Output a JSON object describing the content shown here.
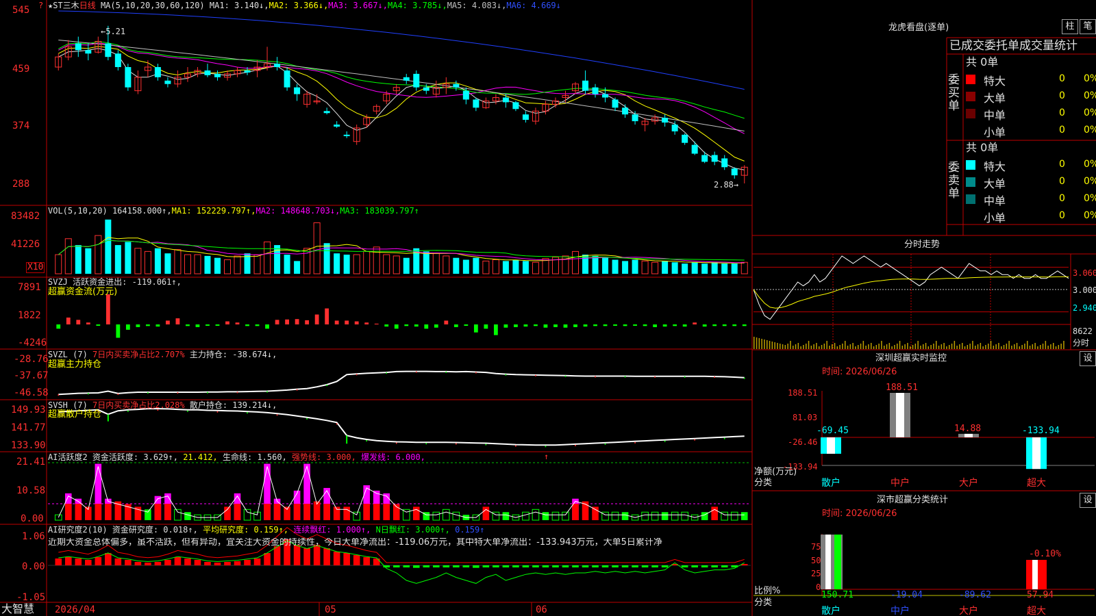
{
  "colors": {
    "up": "#ff3030",
    "down": "#00ffff",
    "frame": "#c00000",
    "ma1": "#e0e0e0",
    "ma2": "#ffff00",
    "ma3": "#ff00ff",
    "ma4": "#00ff00",
    "ma5": "#c0c0c0",
    "ma6": "#2040ff"
  },
  "main": {
    "star": "★",
    "name": "ST三木",
    "period": "日线",
    "ma_label": "MA(5,10,20,30,60,120)",
    "ma1": "MA1: 3.140↓,",
    "ma2": "MA2: 3.366↓,",
    "ma3": "MA3: 3.667↓,",
    "ma4": "MA4: 3.785↓,",
    "ma5": "MA5: 4.083↓,",
    "ma6": "MA6: 4.669↓",
    "y_ticks": [
      "545",
      "459",
      "374",
      "288"
    ],
    "high_label": "←5.21",
    "low_label": "2.88→",
    "corner_q": "?"
  },
  "vol": {
    "label": "VOL(5,10,20)",
    "value": "164158.000↑,",
    "ma1": "MA1: 152229.797↑,",
    "ma2": "MA2: 148648.703↓,",
    "ma3": "MA3: 183039.797↑",
    "y_ticks": [
      "83482",
      "41226"
    ],
    "unit": "X10"
  },
  "svzj": {
    "label": "SVZJ  活跃资金进出: -119.061↑,",
    "sub": "超赢资金流(万元)",
    "y_ticks": [
      "7891",
      "1822",
      "-4246"
    ]
  },
  "svzl": {
    "label": "SVZL (7)",
    "l2": "7日内买卖净占比2.707%",
    "l3": "主力持仓: -38.674↓,",
    "sub": "超赢主力持仓",
    "y_ticks": [
      "-28.76",
      "-37.67",
      "-46.58"
    ]
  },
  "svsh": {
    "label": "SVSH (7)",
    "l2": "7日内买卖净占比2.028%",
    "l3": "散户持仓: 139.214↓,",
    "sub": "超赢散户持仓",
    "y_ticks": [
      "149.93",
      "141.77",
      "133.90"
    ]
  },
  "ai_active": {
    "label": "AI活跃度2",
    "l2": "资金活跃度: 3.629↑,",
    "l3": "21.412,",
    "l4": "生命线: 1.560,",
    "l5": "强势线: 3.000,",
    "l6": "爆发线: 6.000,",
    "arrow": "↑",
    "y_ticks": [
      "21.41",
      "10.58",
      "0.00"
    ]
  },
  "ai_research": {
    "label": "AI研究度2(10)",
    "l2": "资金研究度: 0.018↑,",
    "l3": "平均研究度: 0.159↑,",
    "l4": "连续飘红: 1.000↑,",
    "l5": "N日飘红: 3.000↑,",
    "l6": "0.159↑",
    "comment": "近期大资金总体偏多，虽不活跃，但有异动，宜关注大资金的持续性，今日大单净流出：-119.06万元，其中特大单净流出：-133.943万元，大单5日累计净",
    "y_ticks": [
      "1.06",
      "0.00",
      "-1.05"
    ]
  },
  "xaxis": {
    "brand": "大智慧",
    "d0": "2026/04",
    "d1": "05",
    "d2": "06"
  },
  "lhb": {
    "title": "龙虎看盘(逐单)",
    "btn1": "柱",
    "btn2": "笔",
    "header": "已成交委托单成交量统计",
    "buy": {
      "side": "委买单",
      "total": "共 0单",
      "rows": [
        {
          "name": "特大",
          "v": "0",
          "p": "0%",
          "color": "#ff0000"
        },
        {
          "name": "大单",
          "v": "0",
          "p": "0%",
          "color": "#8b0000"
        },
        {
          "name": "中单",
          "v": "0",
          "p": "0%",
          "color": "#6b0000"
        },
        {
          "name": "小单",
          "v": "0",
          "p": "0%",
          "color": ""
        }
      ]
    },
    "sell": {
      "side": "委卖单",
      "total": "共 0单",
      "rows": [
        {
          "name": "特大",
          "v": "0",
          "p": "0%",
          "color": "#00ffff"
        },
        {
          "name": "大单",
          "v": "0",
          "p": "0%",
          "color": "#008b8b"
        },
        {
          "name": "中单",
          "v": "0",
          "p": "0%",
          "color": "#007070"
        },
        {
          "name": "小单",
          "v": "0",
          "p": "0%",
          "color": ""
        }
      ]
    }
  },
  "intraday": {
    "title": "分时走势",
    "y_ticks": [
      "3.060",
      "3.000",
      "2.940"
    ],
    "vol_tick": "8622",
    "vol_unit": "分时"
  },
  "monitor": {
    "title": "深圳超赢实时监控",
    "btn": "设",
    "time": "时间: 2026/06/26",
    "ylabel": "净额(万元)",
    "xlabel": "分类",
    "y_ticks": [
      "188.51",
      "81.03",
      "-26.46",
      "-133.94"
    ]
  },
  "stats": {
    "title": "深市超赢分类统计",
    "btn": "设",
    "time": "时间: 2026/06/26",
    "ylabel": "比例%",
    "xlabel": "分类",
    "y_ticks": [
      "75",
      "50",
      "25",
      "0"
    ]
  },
  "chart_data": [
    {
      "type": "candlestick",
      "title": "ST三木 日线",
      "ylim": [
        2.88,
        5.45
      ],
      "ohlc": [
        [
          4.6,
          4.75,
          4.55,
          4.8
        ],
        [
          4.75,
          4.9,
          4.7,
          5.0
        ],
        [
          4.95,
          4.85,
          4.75,
          5.05
        ],
        [
          4.85,
          4.8,
          4.7,
          4.95
        ],
        [
          4.82,
          4.98,
          4.8,
          5.05
        ],
        [
          4.95,
          4.75,
          4.7,
          5.21
        ],
        [
          4.8,
          4.6,
          4.55,
          4.85
        ],
        [
          4.6,
          4.3,
          4.25,
          4.65
        ],
        [
          4.25,
          4.45,
          4.2,
          4.55
        ],
        [
          4.55,
          4.6,
          4.45,
          4.7
        ],
        [
          4.6,
          4.45,
          4.4,
          4.65
        ],
        [
          4.4,
          4.35,
          4.3,
          4.45
        ],
        [
          4.35,
          4.45,
          4.3,
          4.55
        ],
        [
          4.45,
          4.5,
          4.38,
          4.6
        ],
        [
          4.5,
          4.55,
          4.45,
          4.6
        ],
        [
          4.55,
          4.48,
          4.45,
          4.65
        ],
        [
          4.5,
          4.45,
          4.4,
          4.55
        ],
        [
          4.45,
          4.5,
          4.4,
          4.55
        ],
        [
          4.5,
          4.55,
          4.45,
          4.6
        ],
        [
          4.55,
          4.52,
          4.48,
          4.6
        ],
        [
          4.55,
          4.6,
          4.45,
          4.7
        ],
        [
          4.6,
          4.65,
          4.55,
          4.9
        ],
        [
          4.65,
          4.6,
          4.55,
          4.75
        ],
        [
          4.55,
          4.3,
          4.25,
          4.6
        ],
        [
          4.3,
          4.2,
          4.1,
          4.35
        ],
        [
          4.05,
          4.2,
          4.0,
          4.25
        ],
        [
          4.1,
          4.1,
          4.05,
          4.2
        ],
        [
          3.95,
          3.92,
          3.9,
          4.0
        ],
        [
          3.75,
          3.72,
          3.7,
          3.8
        ],
        [
          3.6,
          3.58,
          3.55,
          3.65
        ],
        [
          3.5,
          3.7,
          3.45,
          3.75
        ],
        [
          3.75,
          3.85,
          3.7,
          3.9
        ],
        [
          3.95,
          4.02,
          3.9,
          4.05
        ],
        [
          4.1,
          4.2,
          4.05,
          4.25
        ],
        [
          4.25,
          4.3,
          4.2,
          4.35
        ],
        [
          4.45,
          4.4,
          4.35,
          4.5
        ],
        [
          4.5,
          4.3,
          4.25,
          4.55
        ],
        [
          4.3,
          4.25,
          4.2,
          4.35
        ],
        [
          4.2,
          4.3,
          4.15,
          4.4
        ],
        [
          4.3,
          4.35,
          4.2,
          4.45
        ],
        [
          4.35,
          4.3,
          4.25,
          4.4
        ],
        [
          4.25,
          4.12,
          4.05,
          4.3
        ],
        [
          4.12,
          4.0,
          3.95,
          4.15
        ],
        [
          4.0,
          4.1,
          3.98,
          4.15
        ],
        [
          4.1,
          4.15,
          4.05,
          4.2
        ],
        [
          4.15,
          4.08,
          4.0,
          4.2
        ],
        [
          4.08,
          3.98,
          3.95,
          4.1
        ],
        [
          3.9,
          3.82,
          3.78,
          3.95
        ],
        [
          3.8,
          3.95,
          3.75,
          4.0
        ],
        [
          3.95,
          4.05,
          3.9,
          4.1
        ],
        [
          4.05,
          4.1,
          4.0,
          4.15
        ],
        [
          4.15,
          4.18,
          4.08,
          4.25
        ],
        [
          4.25,
          4.35,
          4.2,
          4.38
        ],
        [
          4.4,
          4.25,
          4.2,
          4.55
        ],
        [
          4.3,
          4.2,
          4.15,
          4.35
        ],
        [
          4.2,
          4.15,
          4.08,
          4.3
        ],
        [
          4.12,
          4.0,
          3.95,
          4.15
        ],
        [
          4.0,
          3.9,
          3.85,
          4.05
        ],
        [
          3.9,
          3.8,
          3.75,
          3.95
        ],
        [
          3.75,
          3.8,
          3.65,
          3.85
        ],
        [
          3.8,
          3.85,
          3.75,
          3.9
        ],
        [
          3.85,
          3.78,
          3.72,
          3.9
        ],
        [
          3.75,
          3.65,
          3.6,
          3.8
        ],
        [
          3.6,
          3.48,
          3.45,
          3.62
        ],
        [
          3.45,
          3.32,
          3.3,
          3.5
        ],
        [
          3.3,
          3.2,
          3.18,
          3.35
        ],
        [
          3.3,
          3.2,
          3.15,
          3.35
        ],
        [
          3.25,
          3.12,
          3.08,
          3.3
        ],
        [
          3.1,
          3.0,
          2.95,
          3.12
        ],
        [
          3.0,
          3.12,
          2.88,
          3.15
        ]
      ]
    },
    {
      "type": "bar",
      "title": "VOL(5,10,20)",
      "values": [
        30,
        55,
        45,
        40,
        60,
        85,
        45,
        50,
        40,
        35,
        40,
        32,
        38,
        30,
        30,
        28,
        25,
        22,
        28,
        32,
        30,
        50,
        45,
        30,
        20,
        40,
        80,
        48,
        32,
        30,
        30,
        35,
        42,
        30,
        28,
        25,
        40,
        35,
        32,
        28,
        25,
        22,
        25,
        20,
        22,
        20,
        22,
        20,
        18,
        24,
        26,
        28,
        35,
        30,
        28,
        25,
        22,
        20,
        22,
        20,
        18,
        20,
        18,
        16,
        18,
        16,
        18,
        16,
        16,
        18
      ]
    },
    {
      "type": "bar",
      "title": "SVZJ",
      "values": [
        -0.8,
        1.8,
        1.2,
        0.5,
        -0.2,
        7.9,
        -2.5,
        -1.0,
        -0.5,
        -0.3,
        -0.4,
        1.0,
        1.6,
        -0.3,
        -0.5,
        -0.2,
        -0.2,
        0.8,
        0.5,
        -0.3,
        -0.3,
        -0.8,
        1.2,
        1.3,
        1.4,
        1.1,
        2.6,
        4.2,
        1.0,
        1.0,
        0.8,
        0.5,
        0.2,
        -0.4,
        -0.8,
        -0.3,
        -0.4,
        -0.8,
        -0.6,
        1.0,
        -0.5,
        -0.2,
        -1.5,
        -0.8,
        -2.0,
        -0.6,
        -0.5,
        -0.4,
        -0.3,
        -0.6,
        -0.5,
        -0.6,
        -0.5,
        -0.4,
        -0.3,
        -0.3,
        -0.2,
        -0.3,
        -0.2,
        -0.3,
        -0.5,
        -0.4,
        -0.3,
        -0.4,
        0.5,
        -0.4,
        -0.3,
        -0.3,
        -0.3,
        -0.3
      ]
    },
    {
      "type": "line",
      "title": "SVZL",
      "values": [
        -46.0,
        -45.8,
        -45.5,
        -45.4,
        -45.3,
        -44.5,
        -45.6,
        -45.2,
        -45.0,
        -45.0,
        -45.0,
        -45.0,
        -45.0,
        -45.0,
        -45.0,
        -44.9,
        -44.9,
        -44.8,
        -44.8,
        -44.7,
        -44.6,
        -44.5,
        -44.3,
        -44.0,
        -43.6,
        -43.3,
        -42.5,
        -41.5,
        -40.0,
        -36.8,
        -36.5,
        -36.2,
        -36.0,
        -35.8,
        -35.4,
        -35.3,
        -35.3,
        -35.3,
        -35.4,
        -35.4,
        -35.5,
        -35.4,
        -35.6,
        -35.8,
        -36.3,
        -36.6,
        -36.8,
        -36.9,
        -37.0,
        -37.1,
        -37.2,
        -37.3,
        -37.4,
        -37.5,
        -37.5,
        -37.5,
        -37.5,
        -37.5,
        -37.6,
        -37.6,
        -37.6,
        -37.6,
        -37.6,
        -37.6,
        -37.6,
        -37.6,
        -37.7,
        -37.8,
        -38.0,
        -38.2
      ]
    },
    {
      "type": "line",
      "title": "SVSH",
      "values": [
        148.5,
        148.8,
        149.0,
        149.2,
        149.4,
        147.5,
        149.0,
        149.4,
        149.6,
        149.9,
        149.9,
        149.8,
        149.6,
        149.4,
        149.4,
        149.2,
        149.1,
        149.0,
        148.9,
        148.7,
        148.5,
        148.2,
        147.8,
        147.4,
        146.8,
        146.2,
        145.6,
        144.9,
        144.0,
        138.5,
        137.5,
        136.8,
        136.3,
        136.0,
        135.8,
        135.7,
        135.6,
        135.6,
        135.6,
        135.6,
        135.5,
        135.4,
        135.3,
        135.2,
        135.0,
        134.8,
        134.6,
        134.5,
        134.4,
        134.4,
        134.4,
        134.6,
        134.8,
        135.0,
        135.2,
        135.4,
        135.6,
        135.8,
        136.0,
        136.2,
        136.4,
        136.6,
        136.8,
        137.0,
        137.2,
        137.4,
        137.6,
        137.8,
        138.0,
        138.2
      ]
    },
    {
      "type": "bar",
      "title": "AI活跃度2",
      "values": [
        2,
        10,
        8,
        5,
        21,
        8,
        7,
        6,
        5,
        4,
        9,
        10,
        4,
        3,
        2,
        2,
        2,
        5,
        10,
        4,
        3,
        21,
        8,
        5,
        11,
        21,
        7,
        12,
        5,
        5,
        3,
        13,
        11,
        10,
        6,
        4,
        5,
        3,
        3,
        4,
        3,
        2,
        2,
        5,
        3,
        3,
        2,
        3,
        4,
        3,
        3,
        3,
        8,
        7,
        5,
        3,
        3,
        3,
        2,
        3,
        3,
        3,
        3,
        3,
        2,
        3,
        5,
        3,
        3,
        3
      ]
    },
    {
      "type": "bar",
      "title": "AI研究度2(10)",
      "values": [
        0.1,
        0.12,
        0.1,
        0.08,
        0.12,
        0.18,
        0.1,
        0.08,
        0.05,
        0.04,
        0.05,
        0.08,
        0.12,
        0.1,
        0.08,
        0.05,
        0.04,
        0.05,
        0.06,
        0.08,
        0.1,
        0.18,
        0.28,
        0.38,
        0.3,
        0.25,
        0.3,
        0.25,
        0.2,
        0.18,
        0.15,
        0.12,
        0.1,
        -0.02,
        -0.05,
        -0.1,
        -0.12,
        -0.1,
        -0.08,
        -0.05,
        -0.08,
        -0.1,
        -0.12,
        -0.08,
        -0.06,
        -0.1,
        -0.08,
        -0.06,
        -0.05,
        -0.06,
        -0.05,
        -0.06,
        -0.05,
        -0.05,
        -0.04,
        -0.05,
        -0.04,
        -0.05,
        -0.04,
        -0.05,
        -0.04,
        -0.03,
        0.02,
        -0.03,
        -0.05,
        -0.04,
        -0.03,
        -0.03,
        -0.02,
        0.02
      ]
    },
    {
      "type": "line",
      "title": "分时走势",
      "ylim": [
        2.91,
        3.09
      ],
      "values": [
        3.0,
        2.96,
        2.93,
        2.92,
        2.94,
        2.96,
        2.98,
        3.0,
        3.02,
        3.01,
        3.02,
        3.04,
        3.02,
        3.03,
        3.05,
        3.07,
        3.09,
        3.08,
        3.07,
        3.08,
        3.09,
        3.08,
        3.07,
        3.06,
        3.07,
        3.06,
        3.05,
        3.04,
        3.03,
        3.02,
        3.01,
        3.02,
        3.04,
        3.05,
        3.06,
        3.05,
        3.04,
        3.03,
        3.05,
        3.07,
        3.06,
        3.05,
        3.05,
        3.04,
        3.05,
        3.04,
        3.04,
        3.03,
        3.04,
        3.03,
        3.03,
        3.04,
        3.03,
        3.03,
        3.04,
        3.05,
        3.04,
        3.03
      ]
    },
    {
      "type": "bar",
      "title": "深圳超赢实时监控",
      "categories": [
        "散户",
        "中户",
        "大户",
        "超大"
      ],
      "values": [
        -69.45,
        188.51,
        14.88,
        -133.94
      ],
      "ylim": [
        -133.94,
        188.51
      ]
    },
    {
      "type": "bar",
      "title": "深市超赢分类统计",
      "categories": [
        "散户",
        "中户",
        "大户",
        "超大"
      ],
      "values": [
        150.71,
        -19.04,
        -89.62,
        57.94
      ],
      "top_label": "-0.10%",
      "ylim": [
        0,
        75
      ]
    }
  ]
}
